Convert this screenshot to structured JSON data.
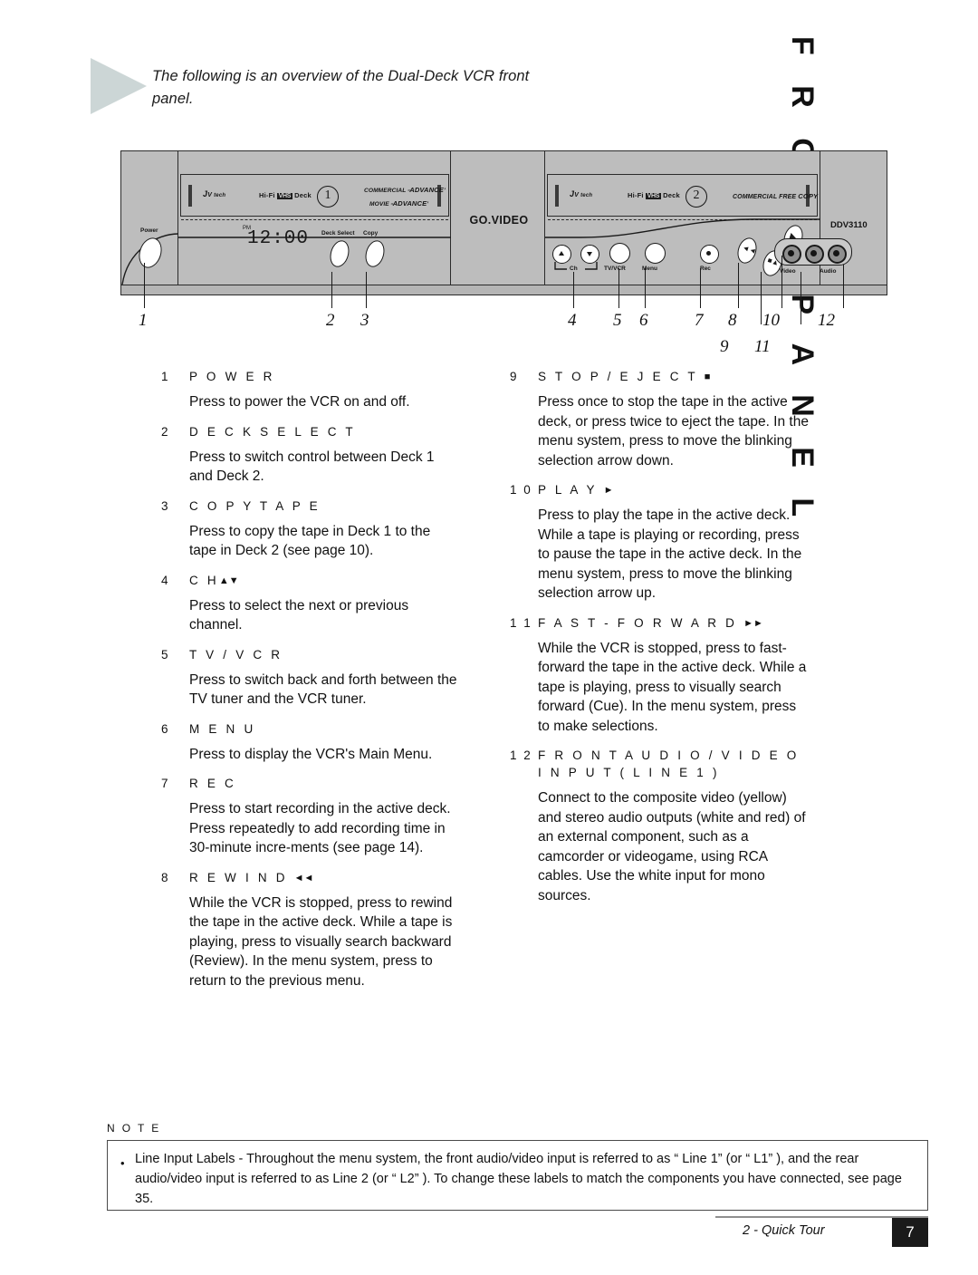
{
  "intro": {
    "text": "The following is an overview of the Dual-Deck VCR front panel."
  },
  "vertical_title": "F R O N T   P A N E L",
  "diagram": {
    "brand": "GO.VIDEO",
    "model": "DDV3110",
    "clock": "12:00",
    "clock_indicator": "PM",
    "deck1": {
      "hifi": "Hi-Fi",
      "vhs": "VHS",
      "deck_word": "Deck",
      "number": "1",
      "feature_line1": "COMMERCIAL",
      "feature_line1_b": "ADVANCE",
      "feature_line2": "MOVIE",
      "feature_line2_b": "ADVANCE"
    },
    "deck2": {
      "hifi": "Hi-Fi",
      "vhs": "VHS",
      "deck_word": "Deck",
      "number": "2",
      "feature_line1": "COMMERCIAL FREE",
      "feature_line1_b": "COPY"
    },
    "buttons": {
      "power": "Power",
      "deck_select": "Deck Select",
      "copy": "Copy",
      "ch": "Ch",
      "tv_vcr": "TV/VCR",
      "menu": "Menu",
      "rec": "Rec",
      "video_jack": "Video",
      "audio_jack": "Audio"
    },
    "callouts": [
      "1",
      "2",
      "3",
      "4",
      "5",
      "6",
      "7",
      "8",
      "9",
      "10",
      "11",
      "12"
    ]
  },
  "left_column": [
    {
      "num": "1",
      "label": "P O W E R",
      "body": "Press to power the VCR on and off."
    },
    {
      "num": "2",
      "label": "D E C K  S E L E C T",
      "body": "Press to switch control between Deck 1 and Deck 2."
    },
    {
      "num": "3",
      "label": "C O P Y  T A P E",
      "body": "Press to copy the tape in Deck 1 to the tape in Deck 2 (see page 10)."
    },
    {
      "num": "4",
      "label": "C H",
      "glyph": "▲▼",
      "body": "Press to select the next or previous channel."
    },
    {
      "num": "5",
      "label": "T V / V C R",
      "body": "Press to switch back and forth between the TV tuner and the VCR tuner."
    },
    {
      "num": "6",
      "label": "M E N U",
      "body": "Press to display the VCR's Main Menu."
    },
    {
      "num": "7",
      "label": "R E C",
      "body": "Press to start recording in the active deck. Press repeatedly to add recording time in 30-minute incre-ments (see page 14)."
    },
    {
      "num": "8",
      "label": "R E W I N D",
      "glyph": "◄◄",
      "body": "While the VCR is stopped, press to rewind the tape in the active deck. While a tape is playing, press to visually search backward (Review). In the menu system, press to return to the previous menu."
    }
  ],
  "right_column": [
    {
      "num": "9",
      "label": "S T O P / E J E C T",
      "glyph": "■",
      "body": "Press once to stop the tape in the active deck, or press twice to eject the tape. In the menu system, press to move the blinking selection arrow down."
    },
    {
      "num": "1 0",
      "label": "P L A Y",
      "glyph": "►",
      "body": "Press to play the tape in the active deck. While a tape is playing or recording, press to pause the tape in the active deck. In the menu system, press to move the blinking selection arrow up."
    },
    {
      "num": "1 1",
      "label": "F A S T - F O R W A R D",
      "glyph": "►►",
      "body": "While the VCR is stopped, press to fast-forward the tape in the active deck. While a tape is playing, press to visually search forward (Cue). In the menu system, press to make selections."
    },
    {
      "num": "1 2",
      "label": "F R O N T  A U D I O / V I D E O",
      "label2": "I N P U T  ( L I N E  1 )",
      "body": "Connect to the composite video (yellow) and stereo audio outputs (white and red) of an external component, such as a camcorder or videogame, using RCA cables. Use the white input for mono sources."
    }
  ],
  "note": {
    "title": "N O T E",
    "bullet": "•",
    "text": "Line Input Labels - Throughout the menu system, the front audio/video input is referred to as “ Line 1” (or “ L1” ), and the rear audio/video input is referred to as Line 2 (or “ L2” ). To change these labels to match the components you have connected, see page 35."
  },
  "footer": {
    "chapter": "2 - Quick Tour",
    "page": "7"
  }
}
